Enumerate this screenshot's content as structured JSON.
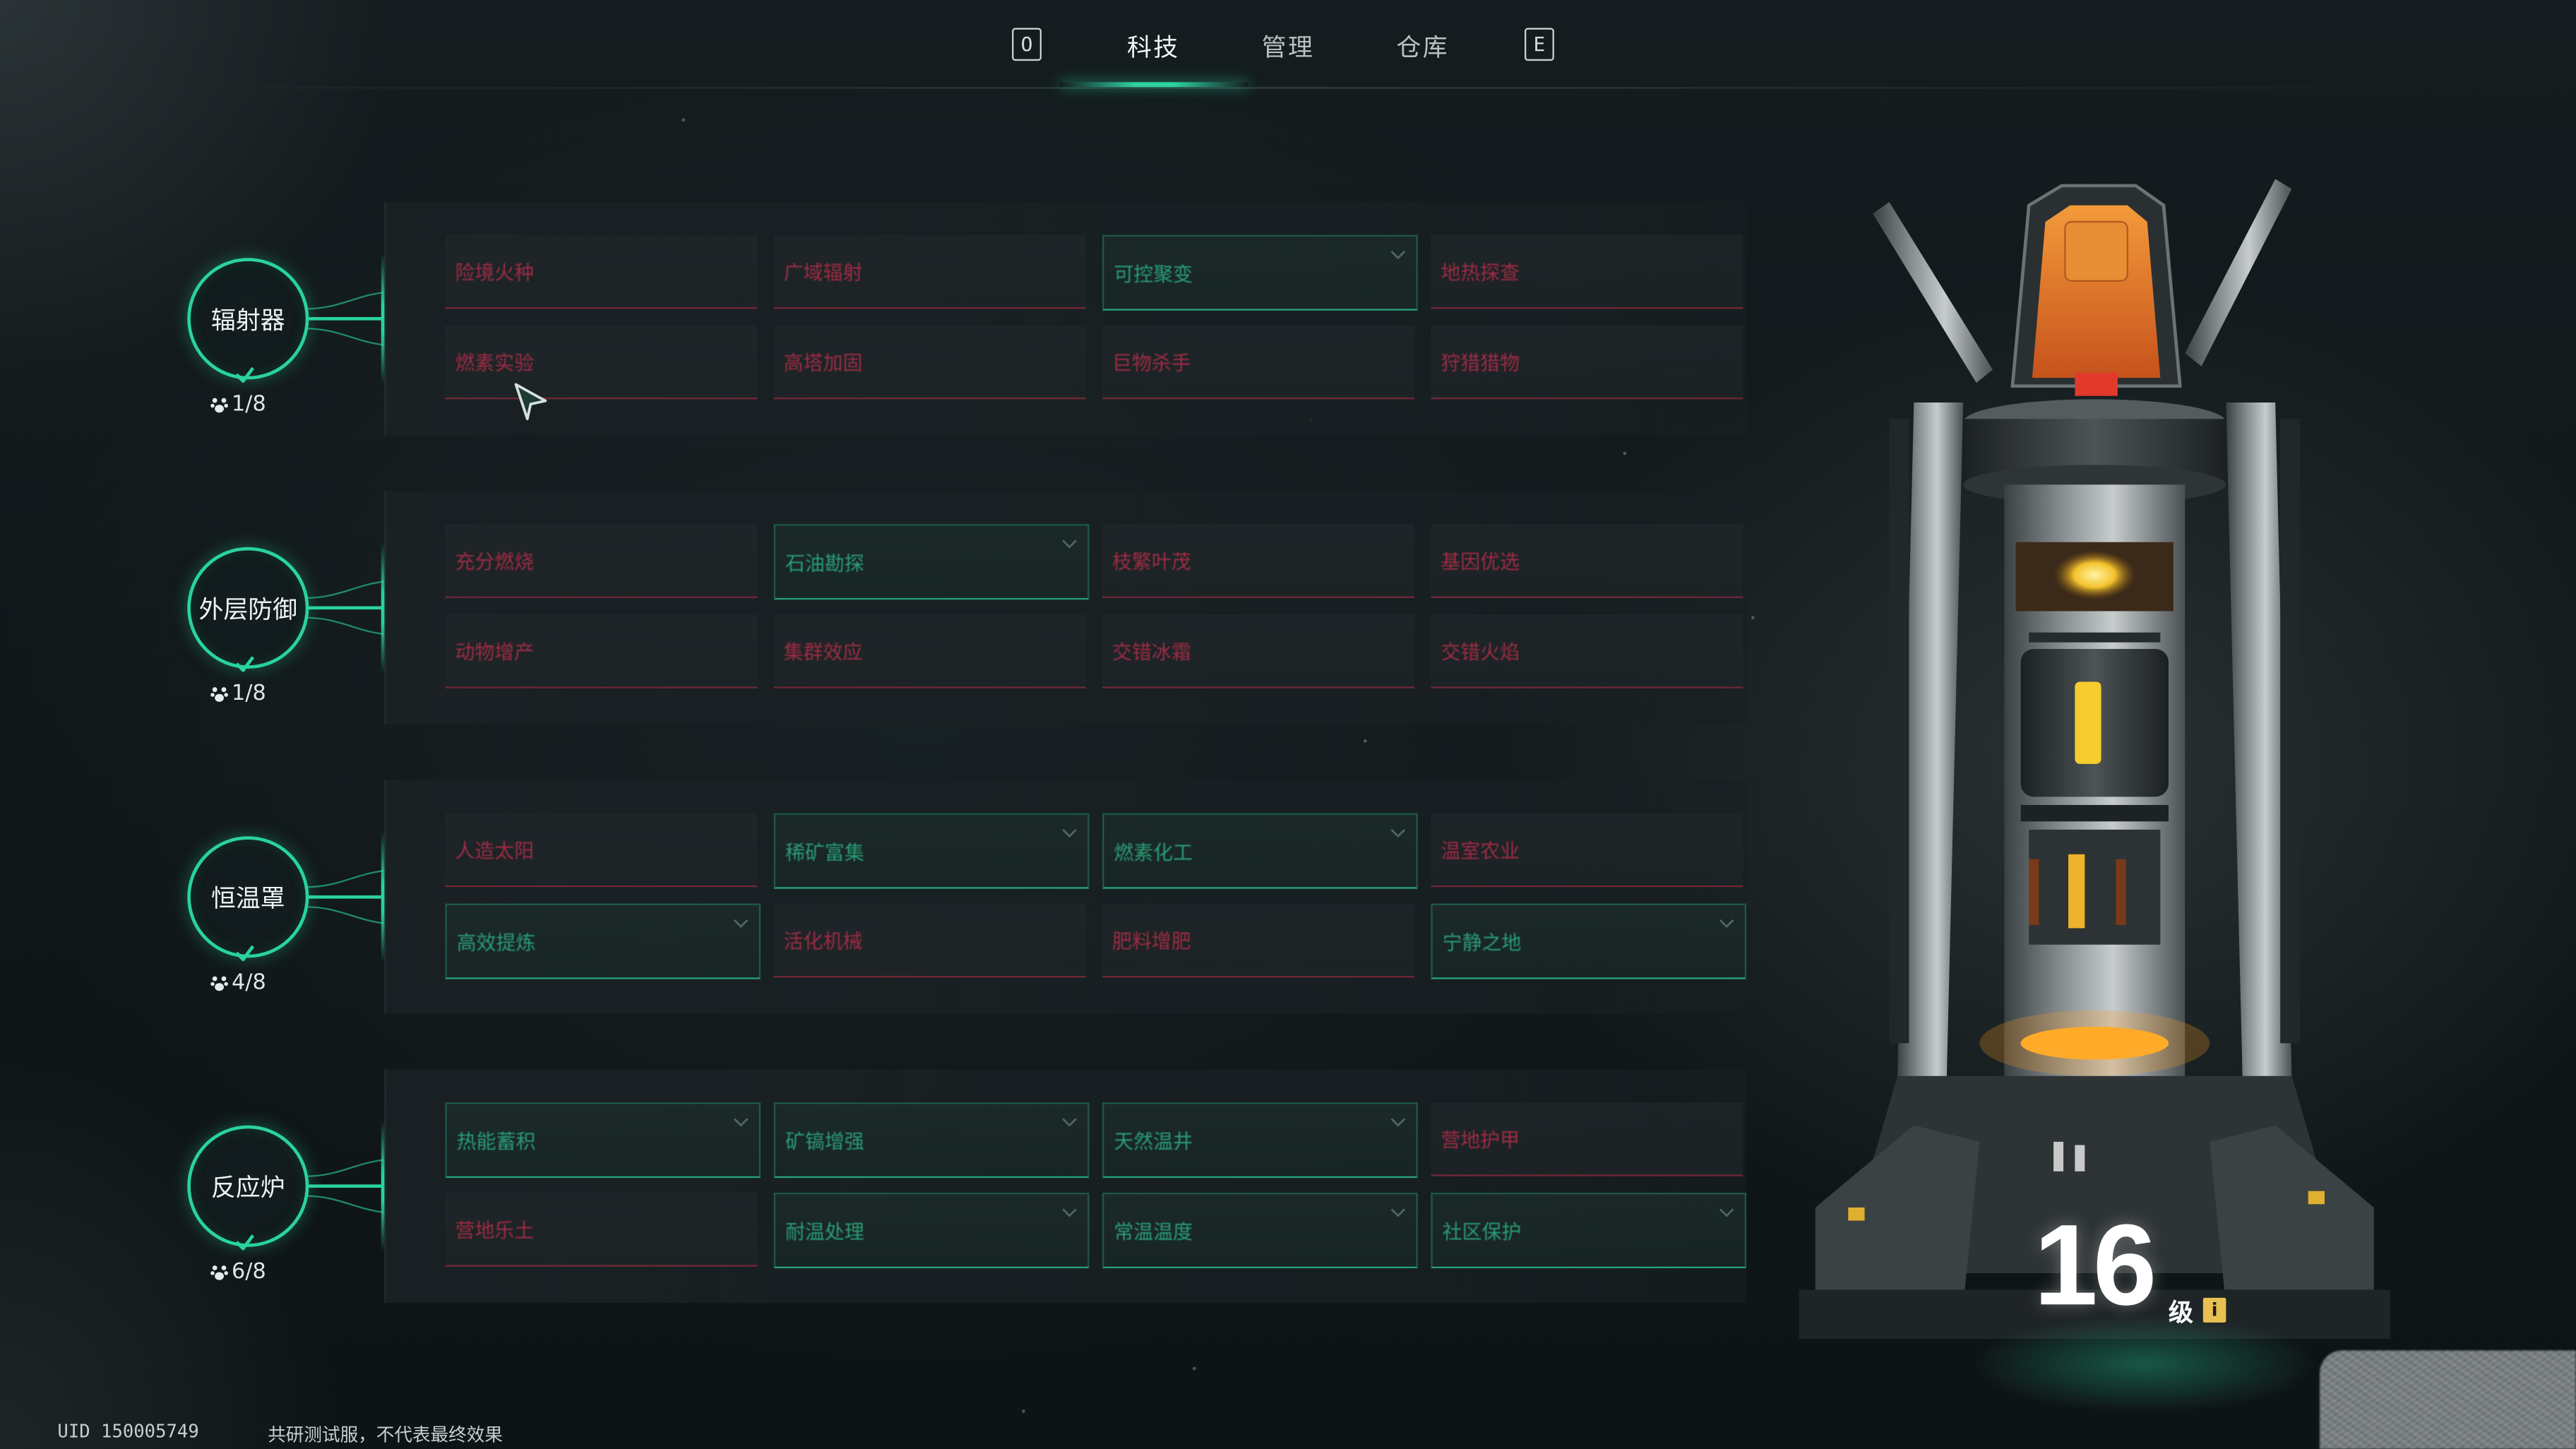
{
  "nav": {
    "left_key": "O",
    "right_key": "E",
    "tabs": [
      {
        "label": "科技",
        "active": true
      },
      {
        "label": "管理",
        "active": false
      },
      {
        "label": "仓库",
        "active": false
      }
    ]
  },
  "branches": [
    {
      "name": "辐射器",
      "progress": "1/8",
      "cells": [
        {
          "label": "险境火种",
          "state": "locked"
        },
        {
          "label": "广域辐射",
          "state": "locked"
        },
        {
          "label": "可控聚变",
          "state": "unlocked"
        },
        {
          "label": "地热探查",
          "state": "locked"
        },
        {
          "label": "燃素实验",
          "state": "locked"
        },
        {
          "label": "高塔加固",
          "state": "locked"
        },
        {
          "label": "巨物杀手",
          "state": "locked"
        },
        {
          "label": "狩猎猎物",
          "state": "locked"
        }
      ]
    },
    {
      "name": "外层防御",
      "progress": "1/8",
      "cells": [
        {
          "label": "充分燃烧",
          "state": "locked"
        },
        {
          "label": "石油勘探",
          "state": "unlocked"
        },
        {
          "label": "枝繁叶茂",
          "state": "locked"
        },
        {
          "label": "基因优选",
          "state": "locked"
        },
        {
          "label": "动物增产",
          "state": "locked"
        },
        {
          "label": "集群效应",
          "state": "locked"
        },
        {
          "label": "交错冰霜",
          "state": "locked"
        },
        {
          "label": "交错火焰",
          "state": "locked"
        }
      ]
    },
    {
      "name": "恒温罩",
      "progress": "4/8",
      "cells": [
        {
          "label": "人造太阳",
          "state": "locked"
        },
        {
          "label": "稀矿富集",
          "state": "unlocked"
        },
        {
          "label": "燃素化工",
          "state": "unlocked"
        },
        {
          "label": "温室农业",
          "state": "locked"
        },
        {
          "label": "高效提炼",
          "state": "unlocked"
        },
        {
          "label": "活化机械",
          "state": "locked"
        },
        {
          "label": "肥料增肥",
          "state": "locked"
        },
        {
          "label": "宁静之地",
          "state": "unlocked"
        }
      ]
    },
    {
      "name": "反应炉",
      "progress": "6/8",
      "cells": [
        {
          "label": "热能蓄积",
          "state": "unlocked"
        },
        {
          "label": "矿镐增强",
          "state": "unlocked"
        },
        {
          "label": "天然温井",
          "state": "unlocked"
        },
        {
          "label": "营地护甲",
          "state": "locked"
        },
        {
          "label": "营地乐土",
          "state": "locked"
        },
        {
          "label": "耐温处理",
          "state": "unlocked"
        },
        {
          "label": "常温温度",
          "state": "unlocked"
        },
        {
          "label": "社区保护",
          "state": "unlocked"
        }
      ]
    }
  ],
  "reactor": {
    "level": "16",
    "level_unit": "级",
    "info_glyph": "i"
  },
  "footer": {
    "uid": "UID 150005749",
    "note": "共研测试服，不代表最终效果"
  },
  "colors": {
    "accent": "#2ad39c",
    "locked_text": "#9e2c45",
    "unlocked_text": "#2a9d76",
    "background": "#0f1619"
  }
}
